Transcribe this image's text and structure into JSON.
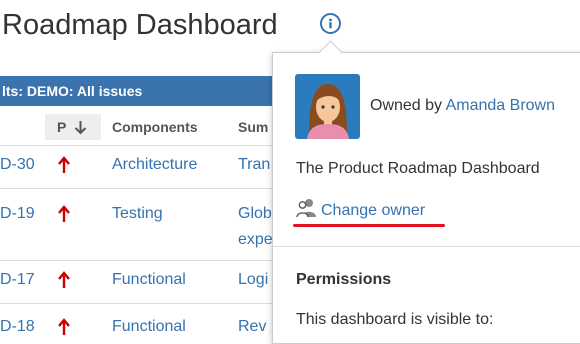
{
  "header": {
    "title": "Roadmap Dashboard",
    "info_icon": "info-circle-icon"
  },
  "gadget": {
    "title": "lts: DEMO: All issues",
    "columns": {
      "priority": "P",
      "components": "Components",
      "summary": "Sum"
    },
    "sort_icon": "arrow-down-icon",
    "rows": [
      {
        "key": "D-30",
        "priority_icon": "priority-high-icon",
        "component": "Architecture",
        "summary": "Tran",
        "summary2": ""
      },
      {
        "key": "D-19",
        "priority_icon": "priority-high-icon",
        "component": "Testing",
        "summary": "Glob",
        "summary2": "expe"
      },
      {
        "key": "D-17",
        "priority_icon": "priority-high-icon",
        "component": "Functional",
        "summary": "Logi",
        "summary2": ""
      },
      {
        "key": "D-18",
        "priority_icon": "priority-high-icon",
        "component": "Functional",
        "summary": "Rev",
        "summary2": ""
      }
    ],
    "colors": {
      "header_bg": "#3b73af",
      "link": "#3572b0",
      "priority_high": "#cc0000"
    }
  },
  "popup": {
    "owned_by_prefix": "Owned by ",
    "owner_name": "Amanda Brown",
    "description": "The Product Roadmap Dashboard",
    "change_owner_label": "Change owner",
    "change_owner_icon": "user-swap-icon",
    "permissions_heading": "Permissions",
    "visible_to_label": "This dashboard is visible to:",
    "highlight_color": "#e0141e"
  }
}
